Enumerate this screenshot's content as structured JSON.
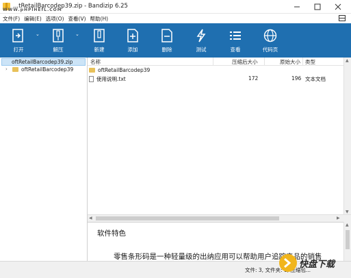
{
  "window": {
    "title": "...tRetailBarcodep39.zip - Bandizip 6.25",
    "watermark_top": "WWW.pHPlHEfL.COM"
  },
  "menu": {
    "items": [
      "文件(F)",
      "编辑(E)",
      "选项(O)",
      "查看(V)",
      "帮助(H)"
    ]
  },
  "toolbar": {
    "items": [
      {
        "label": "打开",
        "icon": "open-icon"
      },
      {
        "label": "解压",
        "icon": "extract-icon"
      },
      {
        "label": "新建",
        "icon": "new-archive-icon"
      },
      {
        "label": "添加",
        "icon": "add-icon"
      },
      {
        "label": "删除",
        "icon": "delete-icon"
      },
      {
        "label": "测试",
        "icon": "test-icon"
      },
      {
        "label": "查看",
        "icon": "view-icon"
      },
      {
        "label": "代码页",
        "icon": "codepage-icon"
      }
    ],
    "background": "#1f6fb0"
  },
  "tree": {
    "root": "oftRetailBarcodep39.zip",
    "child": "oftRetailBarcodep39"
  },
  "list": {
    "columns": [
      "名称",
      "压缩后大小",
      "原始大小",
      "类型"
    ],
    "rows": [
      {
        "name": "oftRetailBarcodep39",
        "icon": "folder-icon",
        "packed": "",
        "size": "",
        "type": ""
      },
      {
        "name": "使用说明.txt",
        "icon": "text-file-icon",
        "packed": "172",
        "size": "196",
        "type": "文本文档"
      }
    ]
  },
  "description": {
    "title": "软件特色",
    "body": "零售条形码是一种轻量级的出纳应用可以帮助用户追踪产品的销售"
  },
  "status": {
    "text": "文件: 3, 文件夹: 1, 压缩包..."
  },
  "watermark": {
    "text": "快盘下载",
    "color": "#f1b51c"
  }
}
